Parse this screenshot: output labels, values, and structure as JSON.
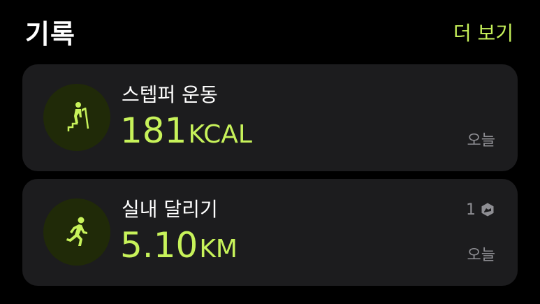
{
  "header": {
    "title": "기록",
    "more_label": "더 보기"
  },
  "records": [
    {
      "icon": "stair-stepper-icon",
      "name": "스텝퍼 운동",
      "value": "181",
      "unit": "KCAL",
      "date": "오늘"
    },
    {
      "icon": "running-icon",
      "name": "실내 달리기",
      "value": "5.10",
      "unit": "KM",
      "date": "오늘",
      "badge_count": "1",
      "badge_icon": "shoe-badge-icon"
    }
  ],
  "colors": {
    "accent": "#c7f25a",
    "card_bg": "#1c1c1e",
    "icon_circle_bg": "#202a08",
    "secondary_text": "#8e8e93",
    "background": "#000000"
  }
}
